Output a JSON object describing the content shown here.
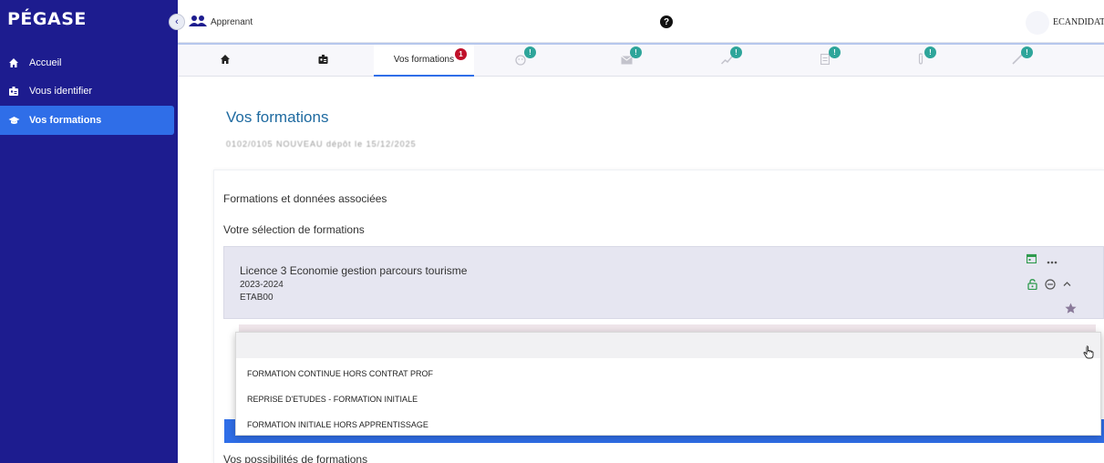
{
  "app": {
    "logo": "PÉGASE"
  },
  "sidebar": {
    "collapse_icon": "‹",
    "items": [
      {
        "label": "Accueil",
        "icon": "home-icon"
      },
      {
        "label": "Vous identifier",
        "icon": "id-card-icon"
      },
      {
        "label": "Vos formations",
        "icon": "graduation-cap-icon",
        "active": true
      }
    ]
  },
  "header": {
    "role": "Apprenant",
    "help": "?",
    "user": "ECANDIDAT"
  },
  "tabs": {
    "items": [
      {
        "icon": "home-icon"
      },
      {
        "icon": "id-card-icon"
      },
      {
        "label": "Vos formations",
        "badge": "1",
        "active": true
      },
      {
        "icon": "face-icon",
        "badge": "!"
      },
      {
        "icon": "mail-icon",
        "badge": "!"
      },
      {
        "icon": "chart-icon",
        "badge": "!"
      },
      {
        "icon": "document-icon",
        "badge": "!"
      },
      {
        "icon": "paperclip-icon",
        "badge": "!"
      },
      {
        "icon": "link-icon",
        "badge": "!"
      }
    ]
  },
  "main": {
    "title": "Vos formations",
    "subtitle_blurred": "0102/0105 NOUVEAU dépôt le 15/12/2025",
    "section_label": "Formations et données associées",
    "selection_label": "Votre sélection de formations",
    "formation": {
      "title": "Licence 3 Economie gestion parcours tourisme",
      "year": "2023-2024",
      "etab": "ETAB00"
    },
    "more_label": "Vos possibilités de formations"
  },
  "dropdown": {
    "options": [
      "FORMATION CONTINUE HORS CONTRAT PROF",
      "REPRISE D'ETUDES - FORMATION INITIALE",
      "FORMATION INITIALE HORS APPRENTISSAGE"
    ]
  },
  "colors": {
    "sidebar": "#1d1c8f",
    "accent": "#2f6ee8",
    "title": "#1e6aa0",
    "badge_red": "#c0102a",
    "badge_teal": "#2ea59a",
    "green": "#2e9a4d",
    "star": "#8a7a9a"
  }
}
